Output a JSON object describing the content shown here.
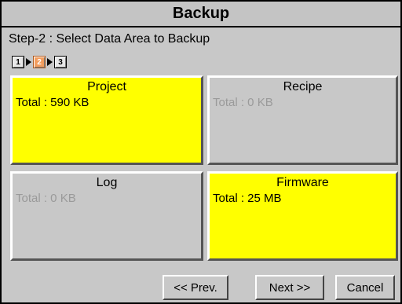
{
  "window": {
    "title": "Backup"
  },
  "step_text": "Step-2 : Select Data Area to Backup",
  "wizard_steps": [
    {
      "label": "1",
      "active": false
    },
    {
      "label": "2",
      "active": true
    },
    {
      "label": "3",
      "active": false
    }
  ],
  "areas": [
    {
      "name": "Project",
      "total": "Total : 590 KB",
      "selected": true
    },
    {
      "name": "Recipe",
      "total": "Total : 0 KB",
      "selected": false
    },
    {
      "name": "Log",
      "total": "Total : 0 KB",
      "selected": false
    },
    {
      "name": "Firmware",
      "total": "Total : 25 MB",
      "selected": true
    }
  ],
  "buttons": {
    "prev": "<< Prev.",
    "next": "Next >>",
    "cancel": "Cancel"
  },
  "colors": {
    "selected": "#ffff00",
    "unselected": "#c8c8c8",
    "active_step": "#f29d5e"
  }
}
